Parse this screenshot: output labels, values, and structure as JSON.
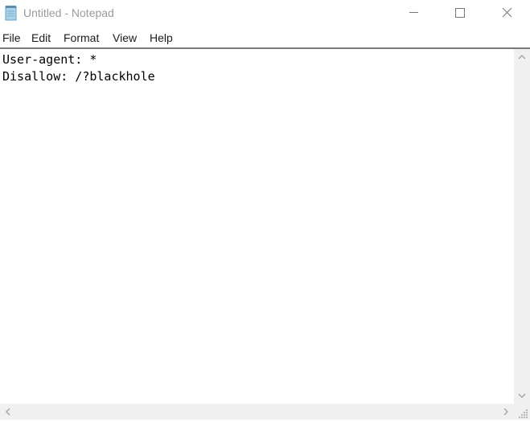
{
  "window": {
    "title": "Untitled - Notepad",
    "app_icon": "notepad-icon",
    "controls": [
      "minimize-icon",
      "maximize-icon",
      "close-icon"
    ]
  },
  "menu": {
    "items": [
      {
        "label": "File"
      },
      {
        "label": "Edit"
      },
      {
        "label": "Format"
      },
      {
        "label": "View"
      },
      {
        "label": "Help"
      }
    ]
  },
  "editor": {
    "content": "User-agent: *\nDisallow: /?blackhole"
  },
  "colors": {
    "title_text": "#9a9a9a",
    "scrollbar_bg": "#f0f0f0",
    "separator": "#7a7a7a"
  }
}
